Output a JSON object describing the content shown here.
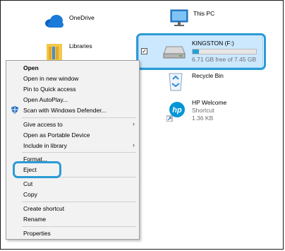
{
  "desktop": {
    "onedrive": {
      "label": "OneDrive"
    },
    "libraries": {
      "label": "Libraries"
    },
    "this_pc": {
      "label": "This PC"
    },
    "drive": {
      "label": "KINGSTON (F:)",
      "free_text": "6.71 GB free of 7.45 GB",
      "used_fraction": 0.1
    },
    "recycle_bin": {
      "label": "Recycle Bin"
    },
    "hp_welcome": {
      "label": "HP Welcome",
      "type": "Shortcut",
      "size": "1.36 KB"
    }
  },
  "context_menu": {
    "items": [
      {
        "label": "Open",
        "bold": true
      },
      {
        "label": "Open in new window"
      },
      {
        "label": "Pin to Quick access"
      },
      {
        "label": "Open AutoPlay..."
      },
      {
        "label": "Scan with Windows Defender..."
      },
      {
        "label": "Give access to",
        "submenu": true
      },
      {
        "label": "Open as Portable Device"
      },
      {
        "label": "Include in library",
        "submenu": true
      },
      {
        "label": "Format..."
      },
      {
        "label": "Eject"
      },
      {
        "label": "Cut"
      },
      {
        "label": "Copy"
      },
      {
        "label": "Create shortcut"
      },
      {
        "label": "Rename"
      },
      {
        "label": "Properties"
      }
    ]
  },
  "colors": {
    "highlight": "#2c9bd6",
    "selection": "#cce8ff",
    "progress": "#26a0da"
  },
  "icons": [
    "onedrive-cloud-icon",
    "libraries-folder-icon",
    "this-pc-monitor-icon",
    "usb-drive-icon",
    "recycle-bin-icon",
    "hp-logo-icon",
    "shield-icon",
    "chevron-right-icon",
    "checkbox-icon"
  ]
}
